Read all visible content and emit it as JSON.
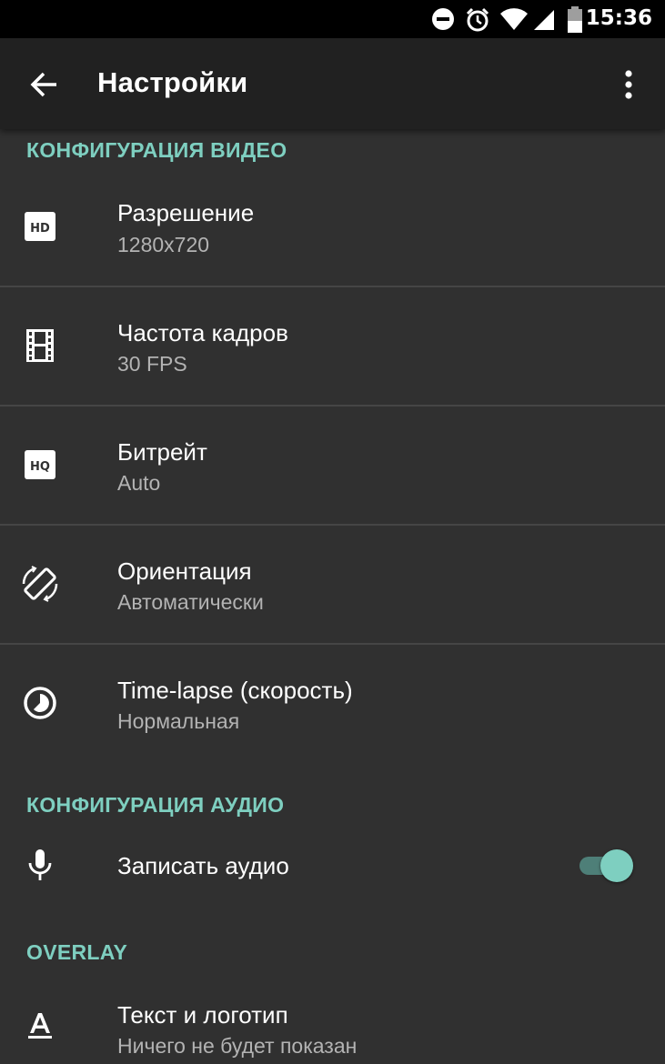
{
  "status_bar": {
    "time": "15:36",
    "icons": [
      "do-not-disturb-icon",
      "alarm-icon",
      "wifi-icon",
      "signal-icon",
      "battery-icon"
    ]
  },
  "toolbar": {
    "title": "Настройки",
    "back_icon": "arrow-back-icon",
    "menu_icon": "more-vert-icon"
  },
  "colors": {
    "accent": "#7ecfc0",
    "background": "#303030",
    "toolbar": "#212121",
    "status_bar": "#000000"
  },
  "sections": {
    "video": {
      "header": "КОНФИГУРАЦИЯ ВИДЕО",
      "items": [
        {
          "icon": "hd-icon",
          "title": "Разрешение",
          "subtitle": "1280x720"
        },
        {
          "icon": "film-icon",
          "title": "Частота кадров",
          "subtitle": "30 FPS"
        },
        {
          "icon": "hq-icon",
          "title": "Битрейт",
          "subtitle": "Auto"
        },
        {
          "icon": "screen-rotation-icon",
          "title": "Ориентация",
          "subtitle": "Автоматически"
        },
        {
          "icon": "timelapse-icon",
          "title": "Time-lapse (скорость)",
          "subtitle": "Нормальная"
        }
      ]
    },
    "audio": {
      "header": "КОНФИГУРАЦИЯ АУДИО",
      "items": [
        {
          "icon": "mic-icon",
          "title": "Записать аудио",
          "toggle_on": true
        }
      ]
    },
    "overlay": {
      "header": "OVERLAY",
      "items": [
        {
          "icon": "text-format-icon",
          "title": "Текст и логотип",
          "subtitle": "Ничего не будет показан"
        }
      ]
    }
  }
}
